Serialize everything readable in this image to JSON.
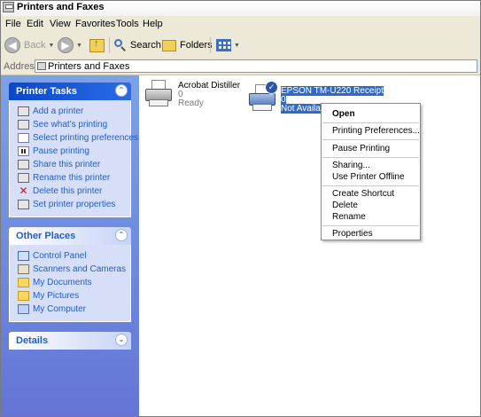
{
  "window": {
    "title": "Printers and Faxes"
  },
  "menubar": {
    "items": [
      "File",
      "Edit",
      "View",
      "Favorites",
      "Tools",
      "Help"
    ]
  },
  "toolbar": {
    "back_label": "Back",
    "search_label": "Search",
    "folders_label": "Folders"
  },
  "address": {
    "label": "Address",
    "value": "Printers and Faxes"
  },
  "taskpane": {
    "printer_tasks": {
      "title": "Printer Tasks",
      "items": [
        {
          "label": "Add a printer",
          "icon": "add-printer-icon"
        },
        {
          "label": "See what's printing",
          "icon": "print-queue-icon"
        },
        {
          "label": "Select printing preferences",
          "icon": "preferences-icon"
        },
        {
          "label": "Pause printing",
          "icon": "pause-icon"
        },
        {
          "label": "Share this printer",
          "icon": "share-icon"
        },
        {
          "label": "Rename this printer",
          "icon": "rename-icon"
        },
        {
          "label": "Delete this printer",
          "icon": "delete-icon"
        },
        {
          "label": "Set printer properties",
          "icon": "properties-icon"
        }
      ]
    },
    "other_places": {
      "title": "Other Places",
      "items": [
        {
          "label": "Control Panel",
          "icon": "control-panel-icon"
        },
        {
          "label": "Scanners and Cameras",
          "icon": "scanner-icon"
        },
        {
          "label": "My Documents",
          "icon": "folder-icon"
        },
        {
          "label": "My Pictures",
          "icon": "pictures-folder-icon"
        },
        {
          "label": "My Computer",
          "icon": "computer-icon"
        }
      ]
    },
    "details": {
      "title": "Details"
    }
  },
  "printers": [
    {
      "name": "Acrobat Distiller",
      "jobs": "0",
      "status": "Ready"
    },
    {
      "name": "EPSON TM-U220 Receipt",
      "jobs": "0",
      "status": "Not Available"
    }
  ],
  "context_menu": {
    "open": "Open",
    "printing_preferences": "Printing Preferences...",
    "pause_printing": "Pause Printing",
    "sharing": "Sharing...",
    "use_offline": "Use Printer Offline",
    "create_shortcut": "Create Shortcut",
    "delete": "Delete",
    "rename": "Rename",
    "properties": "Properties"
  },
  "colors": {
    "selection": "#316ac5",
    "taskpane_top": "#7ba2e7",
    "taskpane_bottom": "#6375d6",
    "link": "#215dc6"
  }
}
